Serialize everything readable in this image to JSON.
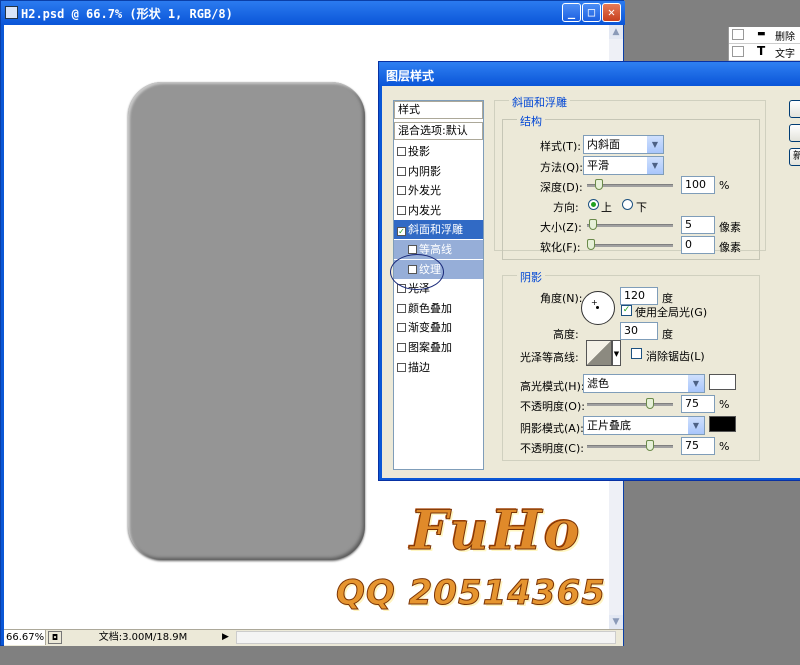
{
  "document": {
    "title": "H2.psd @ 66.7% (形状 1, RGB/8)",
    "zoom": "66.67%",
    "doc_info": "文档:3.00M/18.9M",
    "minimize": "_",
    "maximize": "□",
    "close": "✕"
  },
  "layers_panel": {
    "items": [
      {
        "label": "删除"
      },
      {
        "icon": "T",
        "label": "文字"
      }
    ]
  },
  "watermark": {
    "name": "FuHo",
    "qq": "QQ 20514365"
  },
  "dialog": {
    "title": "图层样式",
    "style_list": {
      "header": "样式",
      "blend": "混合选项:默认",
      "items": [
        {
          "label": "投影",
          "checked": false
        },
        {
          "label": "内阴影",
          "checked": false
        },
        {
          "label": "外发光",
          "checked": false
        },
        {
          "label": "内发光",
          "checked": false
        },
        {
          "label": "斜面和浮雕",
          "checked": true,
          "selected": true
        },
        {
          "label": "等高线",
          "checked": false,
          "sub": true
        },
        {
          "label": "纹理",
          "checked": false,
          "sub": true
        },
        {
          "label": "光泽",
          "checked": false
        },
        {
          "label": "颜色叠加",
          "checked": false
        },
        {
          "label": "渐变叠加",
          "checked": false
        },
        {
          "label": "图案叠加",
          "checked": false
        },
        {
          "label": "描边",
          "checked": false
        }
      ]
    },
    "bevel": {
      "section_title": "斜面和浮雕",
      "structure_title": "结构",
      "style_label": "样式(T):",
      "style_value": "内斜面",
      "technique_label": "方法(Q):",
      "technique_value": "平滑",
      "depth_label": "深度(D):",
      "depth_value": "100",
      "depth_unit": "%",
      "depth_slider": 0.1,
      "direction_label": "方向:",
      "direction_up": "上",
      "direction_down": "下",
      "size_label": "大小(Z):",
      "size_value": "5",
      "size_unit": "像素",
      "size_slider": 0.03,
      "soften_label": "软化(F):",
      "soften_value": "0",
      "soften_unit": "像素",
      "soften_slider": 0.0
    },
    "shading": {
      "title": "阴影",
      "angle_label": "角度(N):",
      "angle_value": "120",
      "angle_unit": "度",
      "global_light": "使用全局光(G)",
      "altitude_label": "高度:",
      "altitude_value": "30",
      "altitude_unit": "度",
      "gloss_label": "光泽等高线:",
      "antialias": "消除锯齿(L)",
      "highlight_label": "高光模式(H):",
      "highlight_value": "滤色",
      "highlight_color": "#ffffff",
      "highlight_opacity_label": "不透明度(O):",
      "highlight_opacity": "75",
      "highlight_opacity_unit": "%",
      "highlight_slider": 0.75,
      "shadow_label": "阴影模式(A):",
      "shadow_value": "正片叠底",
      "shadow_color": "#000000",
      "shadow_opacity_label": "不透明度(C):",
      "shadow_opacity": "75",
      "shadow_opacity_unit": "%",
      "shadow_slider": 0.75
    },
    "buttons": [
      "",
      "",
      "新"
    ]
  }
}
